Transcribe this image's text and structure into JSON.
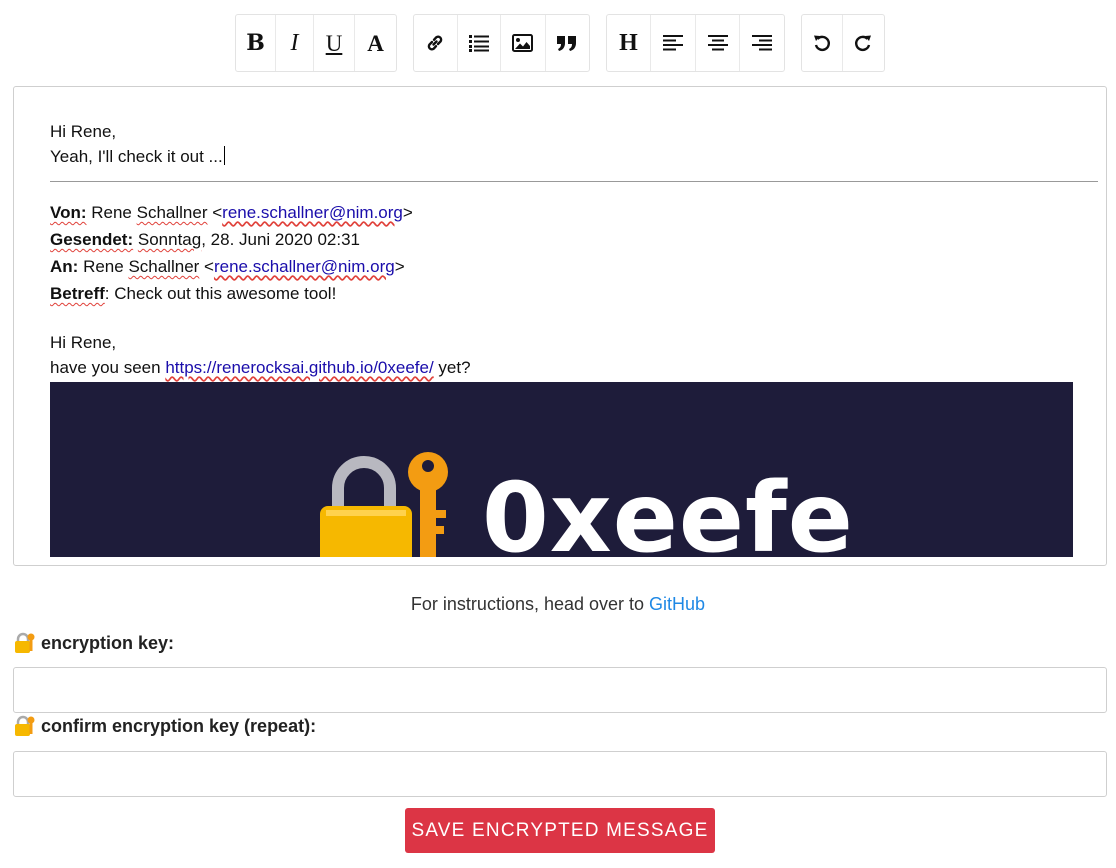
{
  "toolbar": {
    "groups": [
      [
        {
          "name": "bold",
          "glyph": "B"
        },
        {
          "name": "italic",
          "glyph": "I"
        },
        {
          "name": "underline",
          "glyph": "U"
        },
        {
          "name": "font",
          "glyph": "A"
        }
      ],
      [
        {
          "name": "link",
          "icon": "link-icon"
        },
        {
          "name": "list",
          "icon": "list-icon"
        },
        {
          "name": "image",
          "icon": "image-icon"
        },
        {
          "name": "quote",
          "icon": "quote-icon"
        }
      ],
      [
        {
          "name": "heading",
          "glyph": "H"
        },
        {
          "name": "align-left",
          "icon": "align-left-icon"
        },
        {
          "name": "align-center",
          "icon": "align-center-icon"
        },
        {
          "name": "align-right",
          "icon": "align-right-icon"
        }
      ],
      [
        {
          "name": "undo",
          "icon": "undo-icon"
        },
        {
          "name": "redo",
          "icon": "redo-icon"
        }
      ]
    ]
  },
  "editor": {
    "greeting": "Hi Rene,",
    "reply_line": "Yeah, I'll check it out ...",
    "meta": {
      "from_label": "Von:",
      "from_name": "Rene Schallner",
      "from_email": "rene.schallner@nim.org",
      "sent_label": "Gesendet:",
      "sent_day": "Sonntag",
      "sent_rest": ", 28. Juni 2020 02:31",
      "to_label": "An:",
      "to_name": "Rene Schallner",
      "to_email": "rene.schallner@nim.org",
      "subject_label": "Betreff",
      "subject": ": Check out this awesome tool!"
    },
    "quoted_greeting": "Hi Rene,",
    "quoted_prefix": "have you seen ",
    "quoted_link": "https://renerocksai.github.io/0xeefe/",
    "quoted_suffix": " yet?",
    "banner_text": "0xeefe",
    "banner_bg": "#1e1c3a"
  },
  "instructions": {
    "prefix": "For instructions, head over to ",
    "link": "GitHub"
  },
  "form": {
    "key_label": "encryption key:",
    "confirm_label": "confirm encryption key (repeat):",
    "key_value": "",
    "confirm_value": "",
    "save_label": "SAVE ENCRYPTED MESSAGE"
  },
  "colors": {
    "save_button": "#dc3545",
    "link": "#1e88e5"
  }
}
